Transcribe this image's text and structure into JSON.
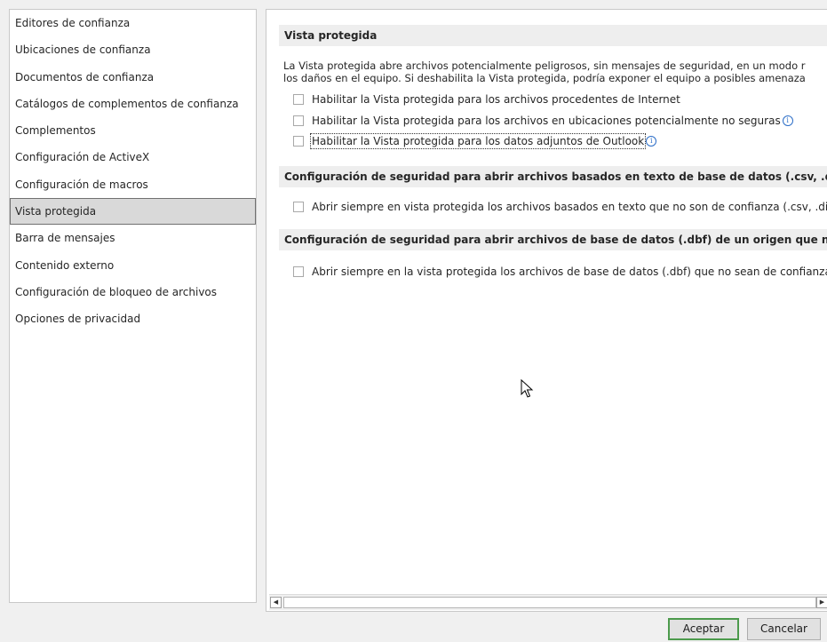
{
  "sidebar": {
    "items": [
      {
        "label": "Editores de confianza"
      },
      {
        "label": "Ubicaciones de confianza"
      },
      {
        "label": "Documentos de confianza"
      },
      {
        "label": "Catálogos de complementos de confianza"
      },
      {
        "label": "Complementos"
      },
      {
        "label": "Configuración de ActiveX"
      },
      {
        "label": "Configuración de macros"
      },
      {
        "label": "Vista protegida",
        "selected": true
      },
      {
        "label": "Barra de mensajes"
      },
      {
        "label": "Contenido externo"
      },
      {
        "label": "Configuración de bloqueo de archivos"
      },
      {
        "label": "Opciones de privacidad"
      }
    ]
  },
  "protected_view": {
    "header": "Vista protegida",
    "description_line1": "La Vista protegida abre archivos potencialmente peligrosos, sin mensajes de seguridad, en un modo r",
    "description_line2": "los daños en el equipo. Si deshabilita la Vista protegida, podría exponer el equipo a posibles amenaza",
    "option_internet": {
      "label": "Habilitar la Vista protegida para los archivos procedentes de Internet",
      "checked": false
    },
    "option_unsafe_locations": {
      "label": "Habilitar la Vista protegida para los archivos en ubicaciones potencialmente no seguras",
      "checked": false
    },
    "option_outlook": {
      "label": "Habilitar la Vista protegida para los datos adjuntos de Outlook",
      "checked": false
    }
  },
  "text_files_section": {
    "header": "Configuración de seguridad para abrir archivos basados en texto de base de datos (.csv, .dif y .sylk)",
    "option": {
      "label": "Abrir siempre en vista protegida los archivos basados en texto que no son de confianza (.csv, .dif y",
      "checked": false
    }
  },
  "dbf_section": {
    "header": "Configuración de seguridad para abrir archivos de base de datos (.dbf) de un origen que no es de c",
    "option": {
      "label": "Abrir siempre en la vista protegida los archivos de base de datos (.dbf) que no sean de confianza",
      "checked": false
    }
  },
  "buttons": {
    "ok": "Aceptar",
    "cancel": "Cancelar"
  },
  "icons": {
    "info": "info-icon",
    "scroll_left": "scroll-left-icon",
    "scroll_right": "scroll-right-icon",
    "cursor": "mouse-pointer-icon"
  }
}
